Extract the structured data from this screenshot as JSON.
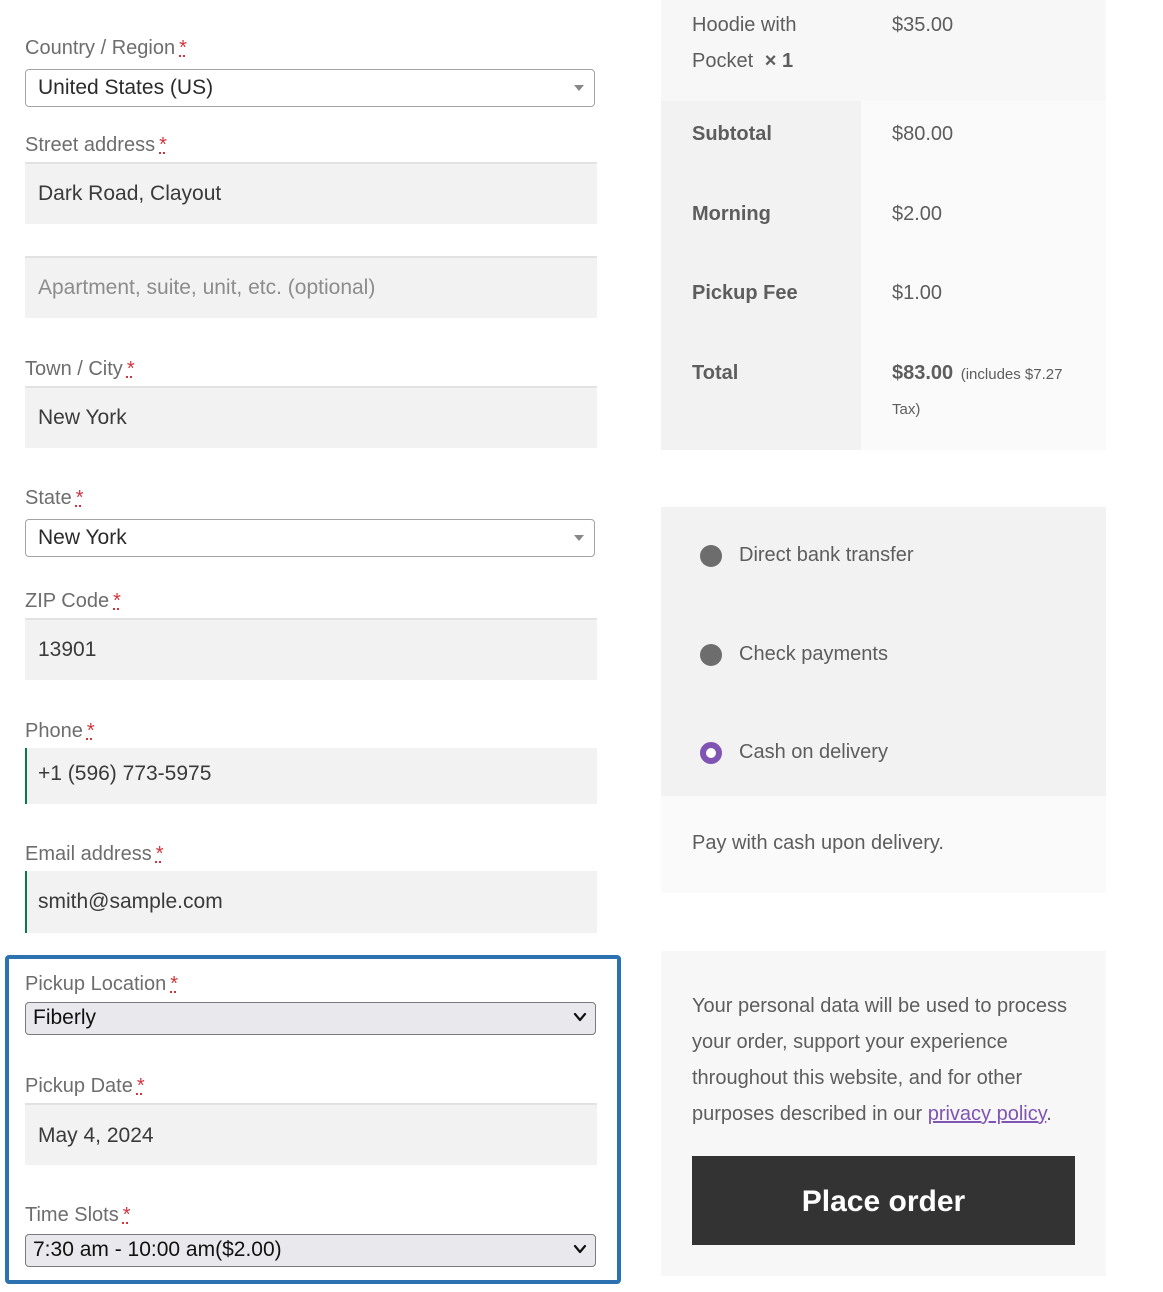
{
  "billing": {
    "country": {
      "label": "Country / Region",
      "value": "United States (US)"
    },
    "street": {
      "label": "Street address",
      "value": "Dark Road, Clayout",
      "apt_placeholder": "Apartment, suite, unit, etc. (optional)"
    },
    "city": {
      "label": "Town / City",
      "value": "New York"
    },
    "state": {
      "label": "State",
      "value": "New York"
    },
    "zip": {
      "label": "ZIP Code",
      "value": "13901"
    },
    "phone": {
      "label": "Phone",
      "value": "+1 (596) 773-5975"
    },
    "email": {
      "label": "Email address",
      "value": "smith@sample.com"
    },
    "required_mark": "*"
  },
  "pickup": {
    "location": {
      "label": "Pickup Location",
      "value": "Fiberly"
    },
    "date": {
      "label": "Pickup Date",
      "value": "May 4, 2024"
    },
    "time_slots": {
      "label": "Time Slots",
      "value": "7:30 am - 10:00 am($2.00)"
    }
  },
  "order": {
    "item": {
      "name_line1": "Hoodie with",
      "name_line2": "Pocket",
      "qty": "× 1",
      "price": "$35.00"
    },
    "subtotal": {
      "label": "Subtotal",
      "value": "$80.00"
    },
    "morning": {
      "label": "Morning",
      "value": "$2.00"
    },
    "pickup_fee": {
      "label": "Pickup Fee",
      "value": "$1.00"
    },
    "total": {
      "label": "Total",
      "value": "$83.00",
      "tax_line1": "(includes $7.27",
      "tax_line2": "Tax)"
    }
  },
  "payment": {
    "methods": [
      {
        "label": "Direct bank transfer",
        "selected": false
      },
      {
        "label": "Check payments",
        "selected": false
      },
      {
        "label": "Cash on delivery",
        "selected": true
      }
    ],
    "description": "Pay with cash upon delivery."
  },
  "privacy": {
    "line1": "Your personal data will be used to process",
    "line2": "your order, support your experience",
    "line3": "throughout this website, and for other",
    "line4_prefix": "purposes described in our ",
    "link": "privacy policy",
    "line4_suffix": "."
  },
  "place_order_label": "Place order",
  "colors": {
    "accent": "#7f54b3",
    "highlight_border": "#2c72b0",
    "button": "#333333"
  }
}
